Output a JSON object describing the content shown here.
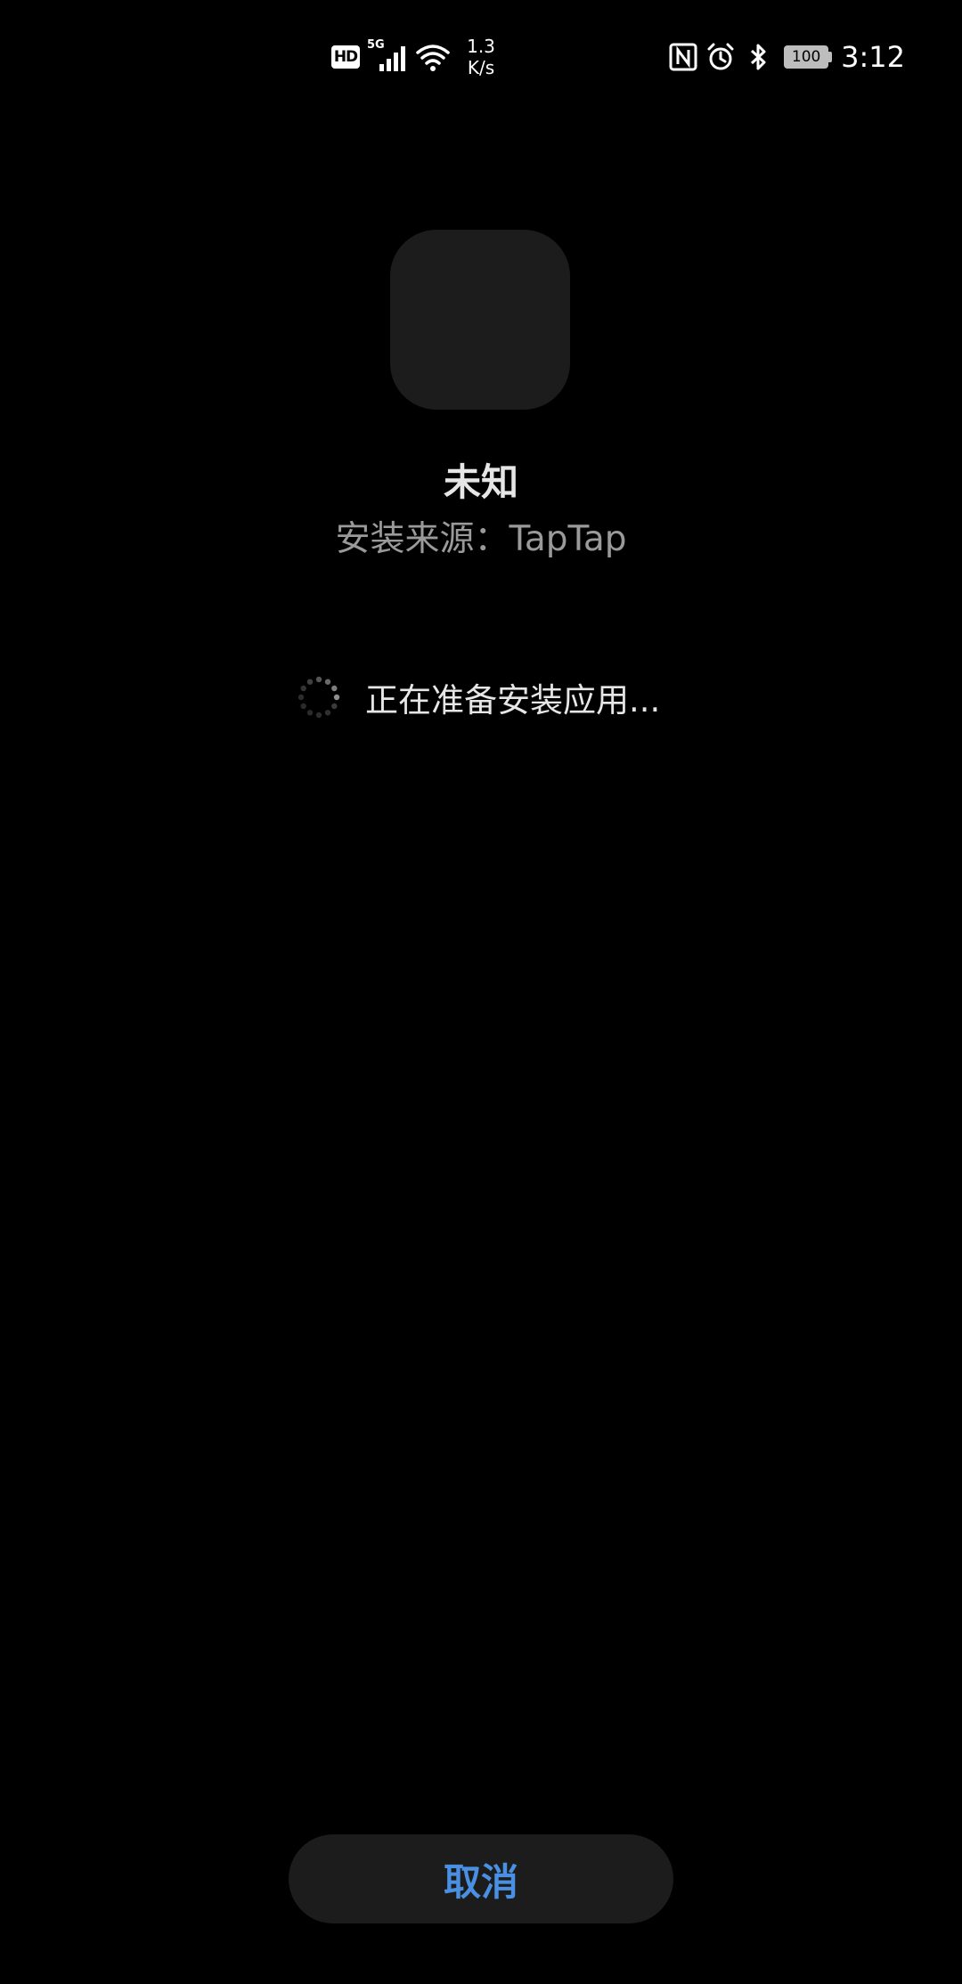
{
  "status_bar": {
    "hd": "HD",
    "network": "5G",
    "speed_value": "1.3",
    "speed_unit": "K/s",
    "battery": "100",
    "time": "3:12",
    "icons": [
      "hd-icon",
      "signal-5g-icon",
      "wifi-icon",
      "nfc-icon",
      "alarm-icon",
      "bluetooth-icon",
      "battery-icon"
    ]
  },
  "app": {
    "name": "未知",
    "source_label": "安装来源：TapTap"
  },
  "progress": {
    "text": "正在准备安装应用..."
  },
  "actions": {
    "cancel_label": "取消"
  },
  "colors": {
    "background": "#000000",
    "surface": "#1c1c1c",
    "accent": "#4a90e2",
    "secondary_text": "#9a9a9a"
  }
}
